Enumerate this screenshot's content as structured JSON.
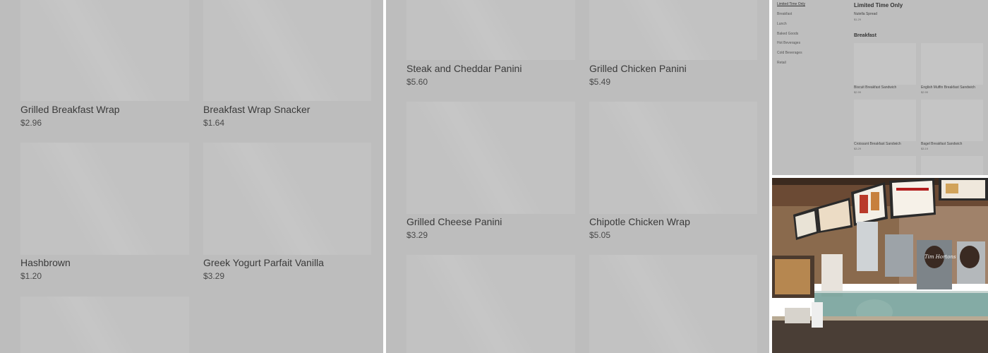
{
  "panel_left": {
    "items": [
      {
        "name": "Grilled Breakfast Wrap",
        "price": "$2.96"
      },
      {
        "name": "Breakfast Wrap Snacker",
        "price": "$1.64"
      },
      {
        "name": "Hashbrown",
        "price": "$1.20"
      },
      {
        "name": "Greek Yogurt Parfait Vanilla",
        "price": "$3.29"
      }
    ]
  },
  "panel_middle": {
    "items": [
      {
        "name": "Steak and Cheddar Panini",
        "price": "$5.60"
      },
      {
        "name": "Grilled Chicken Panini",
        "price": "$5.49"
      },
      {
        "name": "Grilled Cheese Panini",
        "price": "$3.29"
      },
      {
        "name": "Chipotle Chicken Wrap",
        "price": "$5.05"
      }
    ]
  },
  "panel_right": {
    "sidebar": [
      "Limited Time Only",
      "Breakfast",
      "Lunch",
      "Baked Goods",
      "Hot Beverages",
      "Cold Beverages",
      "Retail"
    ],
    "sections": {
      "limited": {
        "title": "Limited Time Only",
        "item": {
          "name": "Nutella Spread",
          "price": "$1.29"
        }
      },
      "breakfast": {
        "title": "Breakfast",
        "items": [
          {
            "name": "Biscuit Breakfast Sandwich",
            "price": "$2.99"
          },
          {
            "name": "English Muffin Breakfast Sandwich",
            "price": "$2.99"
          },
          {
            "name": "Croissant Breakfast Sandwich",
            "price": "$3.29"
          },
          {
            "name": "Bagel Breakfast Sandwich",
            "price": "$3.19"
          }
        ]
      }
    }
  },
  "photo": {
    "logo_text": "Tim Hortons"
  }
}
